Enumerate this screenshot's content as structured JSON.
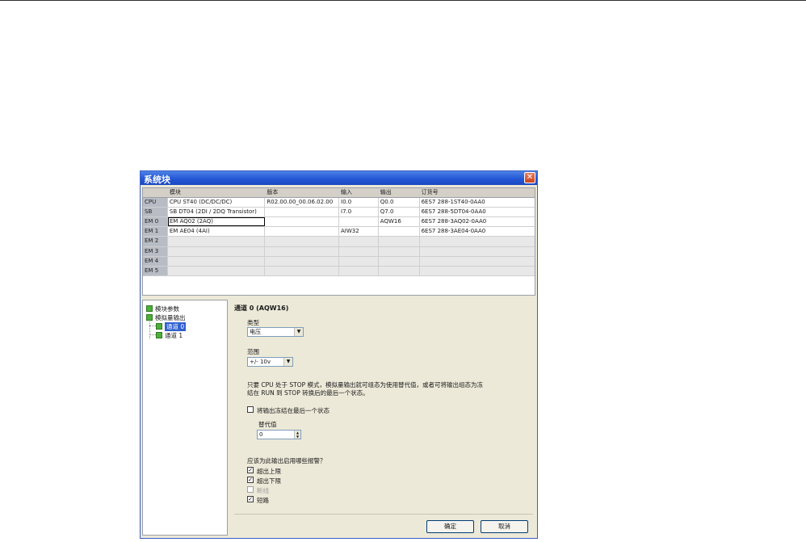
{
  "dialog": {
    "title": "系统块",
    "close_glyph": "✕"
  },
  "grid": {
    "columns": [
      "",
      "模块",
      "版本",
      "输入",
      "输出",
      "订货号"
    ],
    "rows": [
      [
        "CPU",
        "CPU ST40 (DC/DC/DC)",
        "R02.00.00_00.06.02.00",
        "I0.0",
        "Q0.0",
        "6ES7 288-1ST40-0AA0"
      ],
      [
        "SB",
        "SB DT04 (2DI / 2DQ Transistor)",
        "",
        "I7.0",
        "Q7.0",
        "6ES7 288-5DT04-0AA0"
      ],
      [
        "EM 0",
        "EM AQ02 (2AQ)",
        "",
        "",
        "AQW16",
        "6ES7 288-3AQ02-0AA0"
      ],
      [
        "EM 1",
        "EM AE04 (4AI)",
        "",
        "AIW32",
        "",
        "6ES7 288-3AE04-0AA0"
      ],
      [
        "EM 2",
        "",
        "",
        "",
        "",
        ""
      ],
      [
        "EM 3",
        "",
        "",
        "",
        "",
        ""
      ],
      [
        "EM 4",
        "",
        "",
        "",
        "",
        ""
      ],
      [
        "EM 5",
        "",
        "",
        "",
        "",
        ""
      ]
    ]
  },
  "tree": {
    "items": [
      {
        "label": "模块参数",
        "icon": "module-icon"
      },
      {
        "label": "模拟量输出",
        "icon": "module-icon"
      },
      {
        "label": "通道 0",
        "icon": "channel-icon",
        "selected": true
      },
      {
        "label": "通道 1",
        "icon": "channel-icon"
      }
    ]
  },
  "panel": {
    "title": "通道 0 (AQW16)",
    "type_label": "类型",
    "type_value": "电压",
    "range_label": "范围",
    "range_value": "+/- 10v",
    "description": "只要 CPU 处于 STOP 模式，模拟量输出就可组态为使用替代值，或者可将输出组态为冻结在 RUN 到 STOP 转换后的最后一个状态。",
    "description_line1": "只要 CPU 处于 STOP 模式，模拟量输出就可组态为使用替代值，或者可将输出组态为冻",
    "description_line2": "结在 RUN 到 STOP 转换后的最后一个状态。",
    "freeze_label": "将输出冻结在最后一个状态",
    "freeze_checked": false,
    "substitute_label": "替代值",
    "substitute_value": "0",
    "alarm_question": "应该为此输出启用哪些报警？",
    "alarms": [
      {
        "label": "超出上限",
        "checked": true,
        "enabled": true
      },
      {
        "label": "超出下限",
        "checked": true,
        "enabled": true
      },
      {
        "label": "断线",
        "checked": false,
        "enabled": false
      },
      {
        "label": "短路",
        "checked": true,
        "enabled": true
      }
    ],
    "ok_label": "确定",
    "cancel_label": "取消"
  }
}
